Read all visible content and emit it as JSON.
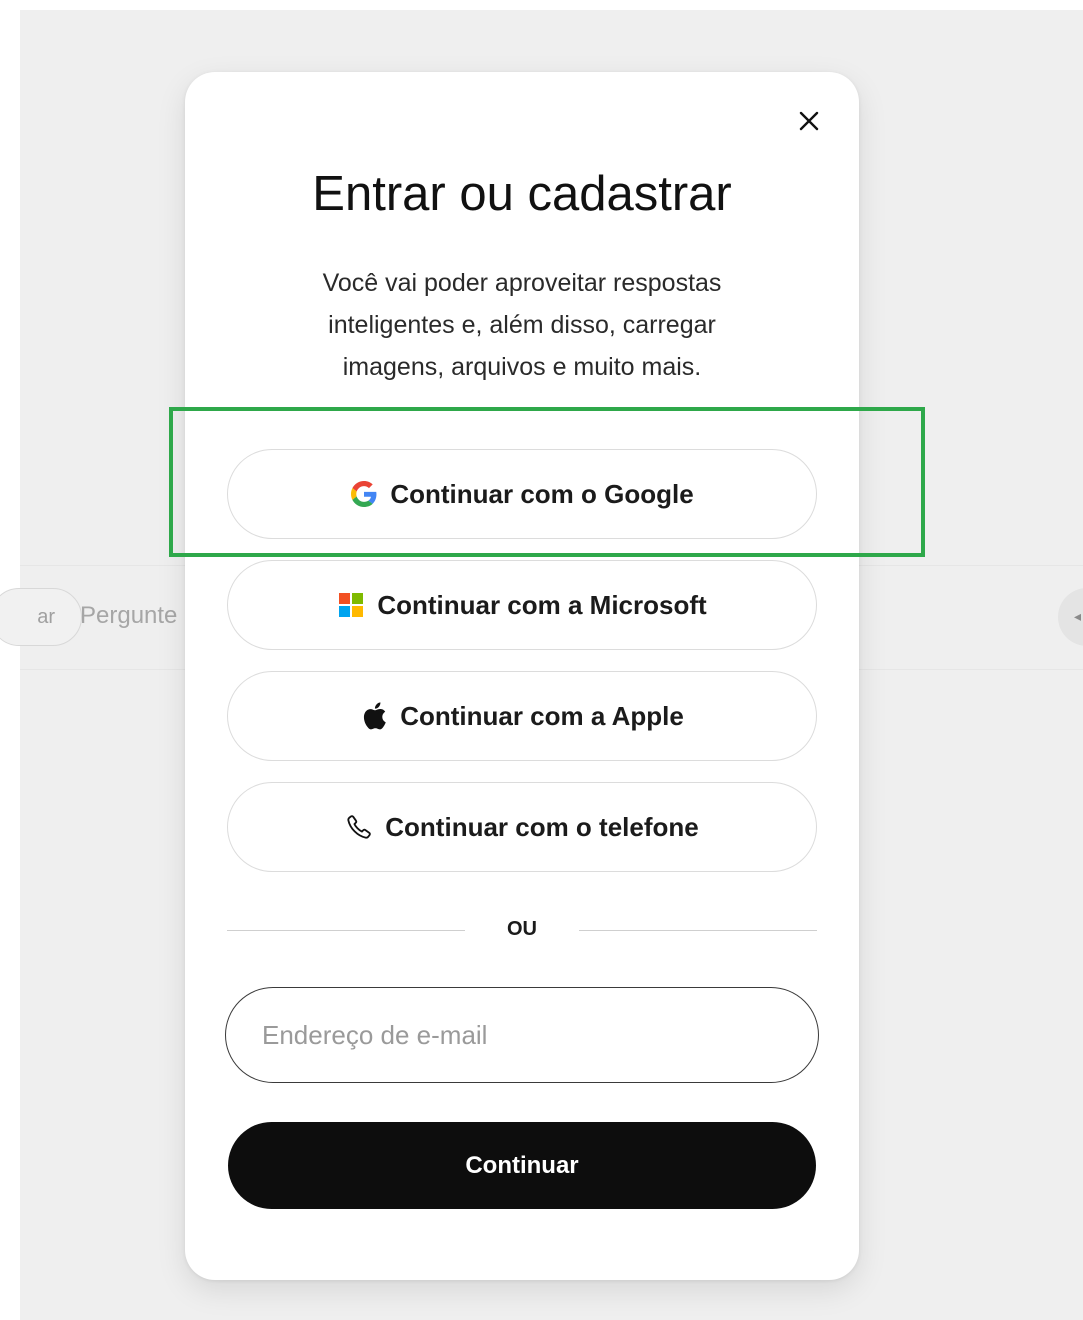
{
  "background": {
    "pill_label": "ar",
    "search_placeholder": "Pergunte"
  },
  "modal": {
    "title": "Entrar ou cadastrar",
    "subtitle": "Você vai poder aproveitar respostas inteligentes e, além disso, carregar imagens, arquivos e muito mais.",
    "buttons": {
      "google": {
        "label": "Continuar com o Google",
        "icon": "google-icon"
      },
      "microsoft": {
        "label": "Continuar com a Microsoft",
        "icon": "microsoft-icon"
      },
      "apple": {
        "label": "Continuar com a Apple",
        "icon": "apple-icon"
      },
      "phone": {
        "label": "Continuar com o telefone",
        "icon": "phone-icon"
      }
    },
    "divider_text": "OU",
    "email": {
      "placeholder": "Endereço de e-mail",
      "value": ""
    },
    "continue_label": "Continuar"
  },
  "colors": {
    "highlight": "#2ea84a",
    "primary_button": "#0d0d0d",
    "backdrop": "#efefef"
  }
}
